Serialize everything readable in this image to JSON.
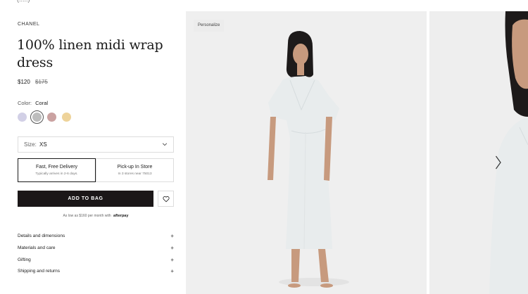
{
  "header": {
    "crumb": "(.....)"
  },
  "product": {
    "brand": "CHANEL",
    "title": "100% linen midi wrap dress",
    "price_now": "$120",
    "price_was": "$175"
  },
  "color": {
    "label": "Color:",
    "value": "Coral",
    "swatches": [
      {
        "name": "lavender",
        "hex": "#d2d0e6"
      },
      {
        "name": "grey",
        "hex": "#bdbdbd",
        "selected": true
      },
      {
        "name": "coral",
        "hex": "#caa2a1"
      },
      {
        "name": "yellow",
        "hex": "#eed39a"
      }
    ]
  },
  "size": {
    "label": "Size:",
    "value": "XS"
  },
  "delivery": {
    "fast": {
      "title": "Fast, Free Delivery",
      "sub": "Typically arrives in 2-6 days."
    },
    "pickup": {
      "title": "Pick-up In Store",
      "sub": "In 3 stores near 75013"
    }
  },
  "actions": {
    "add_to_bag": "ADD TO BAG"
  },
  "afterpay": {
    "text": "As low as $160 per month with",
    "brand": "afterpay"
  },
  "accordion": [
    {
      "label": "Details and dimensions"
    },
    {
      "label": "Materials and care"
    },
    {
      "label": "Gifting"
    },
    {
      "label": "Shipping and returns"
    }
  ],
  "gallery": {
    "personalize_label": "Personalize"
  },
  "colors": {
    "primary": "#1b1718",
    "border": "#dddddd",
    "photo_bg": "#efefef"
  }
}
